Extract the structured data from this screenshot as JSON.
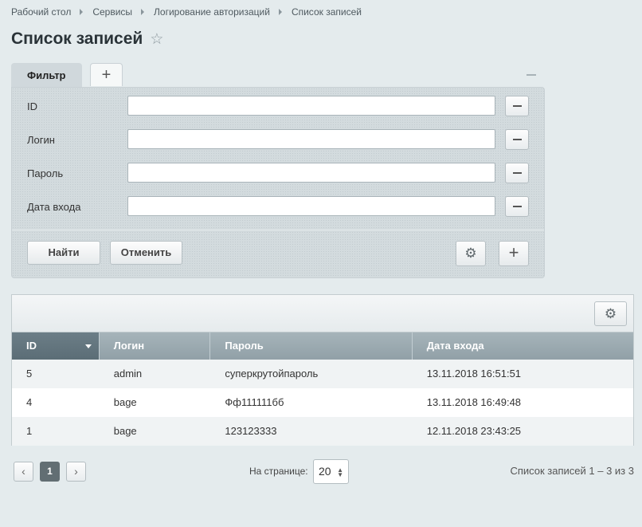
{
  "breadcrumb": [
    "Рабочий стол",
    "Сервисы",
    "Логирование авторизаций",
    "Список записей"
  ],
  "page_title": "Список записей",
  "filter": {
    "tab_label": "Фильтр",
    "add_tab_label": "+",
    "fields": [
      {
        "label": "ID",
        "value": ""
      },
      {
        "label": "Логин",
        "value": ""
      },
      {
        "label": "Пароль",
        "value": ""
      },
      {
        "label": "Дата входа",
        "value": ""
      }
    ],
    "find_label": "Найти",
    "cancel_label": "Отменить",
    "add_label": "+"
  },
  "grid": {
    "columns": [
      "ID",
      "Логин",
      "Пароль",
      "Дата входа"
    ],
    "rows": [
      [
        "5",
        "admin",
        "суперкрутойпароль",
        "13.11.2018 16:51:51"
      ],
      [
        "4",
        "bage",
        "Фф111111бб",
        "13.11.2018 16:49:48"
      ],
      [
        "1",
        "bage",
        "123123333",
        "12.11.2018 23:43:25"
      ]
    ]
  },
  "pager": {
    "prev": "‹",
    "current_page": "1",
    "next": "›",
    "per_page_label": "На странице:",
    "per_page_value": "20",
    "summary": "Список записей 1 – 3 из 3"
  }
}
